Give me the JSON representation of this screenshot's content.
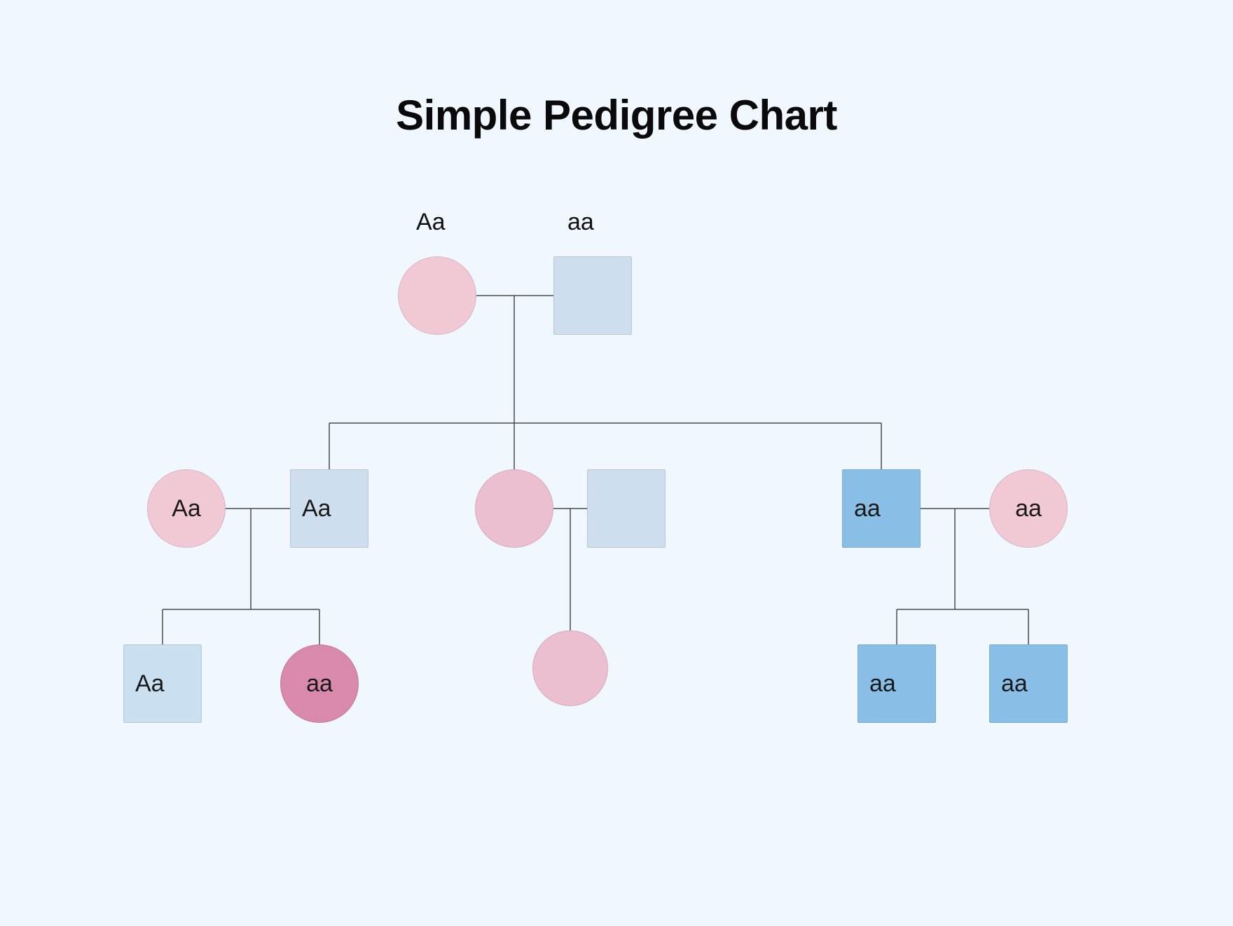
{
  "title": "Simple Pedigree Chart",
  "chart_data": {
    "type": "pedigree",
    "legend_implicit": {
      "circle": "female",
      "square": "male",
      "pink_shades": "female coloring (darker = affected)",
      "blue_shades": "male coloring (darker = affected)"
    },
    "generations": [
      {
        "generation": 1,
        "couples": [
          {
            "mother": {
              "id": "g1_f1",
              "shape": "circle",
              "genotype_label_above": "Aa",
              "color": "pink-light"
            },
            "father": {
              "id": "g1_m1",
              "shape": "square",
              "genotype_label_above": "aa",
              "color": "blue-vlight"
            },
            "children_ref": "g2_set1"
          }
        ]
      },
      {
        "generation": 2,
        "persons": [
          {
            "id": "g2_f_ext1",
            "shape": "circle",
            "genotype": "Aa",
            "color": "pink-light",
            "married_in": true
          },
          {
            "id": "g2_m1",
            "shape": "square",
            "genotype": "Aa",
            "color": "blue-vlight",
            "from_couple": "g1"
          },
          {
            "id": "g2_f2",
            "shape": "circle",
            "genotype": "",
            "color": "pink-mid",
            "from_couple": "g1"
          },
          {
            "id": "g2_m_ext2",
            "shape": "square",
            "genotype": "",
            "color": "blue-vlight",
            "married_in": true
          },
          {
            "id": "g2_m3",
            "shape": "square",
            "genotype": "aa",
            "color": "blue-mid",
            "from_couple": "g1"
          },
          {
            "id": "g2_f_ext3",
            "shape": "circle",
            "genotype": "aa",
            "color": "pink-light",
            "married_in": true
          }
        ],
        "couples": [
          {
            "left": "g2_f_ext1",
            "right": "g2_m1",
            "children_ref": "g3_set1"
          },
          {
            "left": "g2_f2",
            "right": "g2_m_ext2",
            "children_ref": "g3_set2"
          },
          {
            "left": "g2_m3",
            "right": "g2_f_ext3",
            "children_ref": "g3_set3"
          }
        ]
      },
      {
        "generation": 3,
        "persons": [
          {
            "id": "g3_m1",
            "shape": "square",
            "genotype": "Aa",
            "color": "blue-light",
            "parent_couple": "g3_set1"
          },
          {
            "id": "g3_f1",
            "shape": "circle",
            "genotype": "aa",
            "color": "pink-dark",
            "parent_couple": "g3_set1"
          },
          {
            "id": "g3_f2",
            "shape": "circle",
            "genotype": "",
            "color": "pink-mid",
            "parent_couple": "g3_set2"
          },
          {
            "id": "g3_m3",
            "shape": "square",
            "genotype": "aa",
            "color": "blue-mid",
            "parent_couple": "g3_set3"
          },
          {
            "id": "g3_m4",
            "shape": "square",
            "genotype": "aa",
            "color": "blue-mid",
            "parent_couple": "g3_set3"
          }
        ]
      }
    ]
  },
  "labels": {
    "g1_above_f": "Aa",
    "g1_above_m": "aa",
    "g2_f_ext1": "Aa",
    "g2_m1": "Aa",
    "g2_m3": "aa",
    "g2_f_ext3": "aa",
    "g3_m1": "Aa",
    "g3_f1": "aa",
    "g3_m3": "aa",
    "g3_m4": "aa"
  }
}
